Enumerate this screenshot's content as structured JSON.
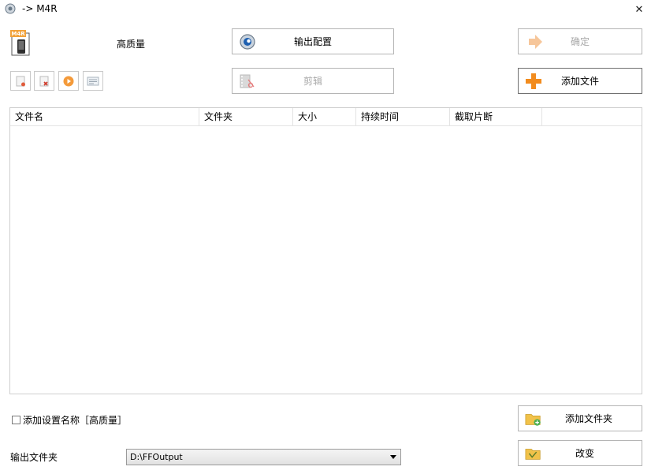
{
  "window": {
    "title": "-> M4R",
    "close_glyph": "✕"
  },
  "format": {
    "icon_text": "M4R",
    "quality": "高质量"
  },
  "buttons": {
    "output_config": "输出配置",
    "ok": "确定",
    "edit": "剪辑",
    "add_file": "添加文件",
    "add_folder": "添加文件夹",
    "change": "改变"
  },
  "toolbar": [
    "new-file-icon",
    "remove-file-icon",
    "play-icon",
    "info-icon"
  ],
  "table": {
    "columns": [
      "文件名",
      "文件夹",
      "大小",
      "持续时间",
      "截取片断"
    ]
  },
  "options": {
    "add_setting_name": "添加设置名称［高质量］"
  },
  "output": {
    "label": "输出文件夹",
    "path": "D:\\FFOutput"
  },
  "colors": {
    "accent_orange": "#f28c1e",
    "disabled_text": "#a8a8a8",
    "border": "#b5b5b5"
  }
}
